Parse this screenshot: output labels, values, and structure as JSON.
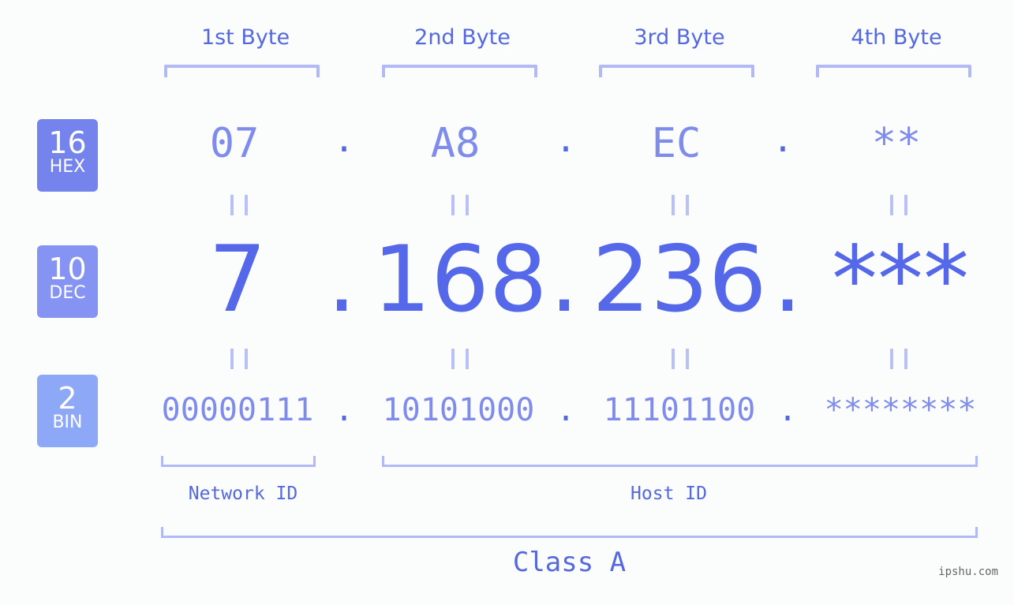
{
  "byte_labels": [
    "1st Byte",
    "2nd Byte",
    "3rd Byte",
    "4th Byte"
  ],
  "badges": {
    "hex": {
      "num": "16",
      "label": "HEX",
      "color": "#7584ec"
    },
    "dec": {
      "num": "10",
      "label": "DEC",
      "color": "#8594f2"
    },
    "bin": {
      "num": "2",
      "label": "BIN",
      "color": "#8ea8f8"
    }
  },
  "hex": [
    "07",
    "A8",
    "EC",
    "**"
  ],
  "dec": [
    "7",
    "168",
    "236",
    "***"
  ],
  "bin": [
    "00000111",
    "10101000",
    "11101100",
    "********"
  ],
  "separator": ".",
  "sections": {
    "network": "Network ID",
    "host": "Host ID",
    "class": "Class A"
  },
  "watermark": "ipshu.com",
  "colors": {
    "accent": "#5468e0",
    "light_accent": "#7f8cec",
    "bracket": "#b2baf5",
    "background": "#fbfdfc"
  }
}
